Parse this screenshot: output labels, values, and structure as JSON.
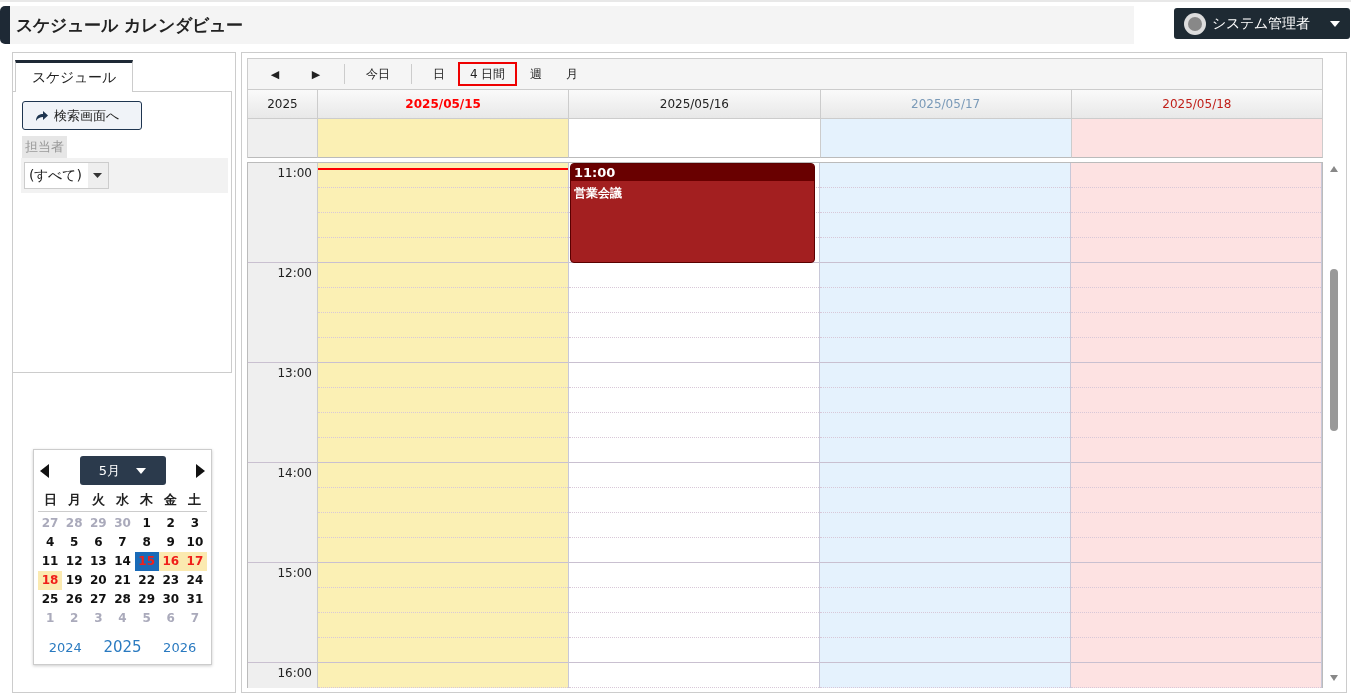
{
  "page_title": "スケジュール カレンダビュー",
  "user_menu": {
    "name": "システム管理者"
  },
  "sidebar": {
    "tabs": [
      {
        "label": "スケジュール",
        "selected": true
      }
    ],
    "search_button": "検索画面へ",
    "filter": {
      "label": "担当者",
      "value": "(すべて)"
    }
  },
  "mini_calendar": {
    "month": "5月",
    "weekdays": [
      "日",
      "月",
      "火",
      "水",
      "木",
      "金",
      "土"
    ],
    "weeks": [
      [
        {
          "day": "27",
          "in_month": false,
          "highlighted": false,
          "selected": false
        },
        {
          "day": "28",
          "in_month": false,
          "highlighted": false,
          "selected": false
        },
        {
          "day": "29",
          "in_month": false,
          "highlighted": false,
          "selected": false
        },
        {
          "day": "30",
          "in_month": false,
          "highlighted": false,
          "selected": false
        },
        {
          "day": "1",
          "in_month": true,
          "highlighted": false,
          "selected": false
        },
        {
          "day": "2",
          "in_month": true,
          "highlighted": false,
          "selected": false
        },
        {
          "day": "3",
          "in_month": true,
          "highlighted": false,
          "selected": false
        }
      ],
      [
        {
          "day": "4",
          "in_month": true,
          "highlighted": false,
          "selected": false
        },
        {
          "day": "5",
          "in_month": true,
          "highlighted": false,
          "selected": false
        },
        {
          "day": "6",
          "in_month": true,
          "highlighted": false,
          "selected": false
        },
        {
          "day": "7",
          "in_month": true,
          "highlighted": false,
          "selected": false
        },
        {
          "day": "8",
          "in_month": true,
          "highlighted": false,
          "selected": false
        },
        {
          "day": "9",
          "in_month": true,
          "highlighted": false,
          "selected": false
        },
        {
          "day": "10",
          "in_month": true,
          "highlighted": false,
          "selected": false
        }
      ],
      [
        {
          "day": "11",
          "in_month": true,
          "highlighted": false,
          "selected": false
        },
        {
          "day": "12",
          "in_month": true,
          "highlighted": false,
          "selected": false
        },
        {
          "day": "13",
          "in_month": true,
          "highlighted": false,
          "selected": false
        },
        {
          "day": "14",
          "in_month": true,
          "highlighted": false,
          "selected": false
        },
        {
          "day": "15",
          "in_month": true,
          "highlighted": true,
          "selected": true
        },
        {
          "day": "16",
          "in_month": true,
          "highlighted": true,
          "selected": false
        },
        {
          "day": "17",
          "in_month": true,
          "highlighted": true,
          "selected": false
        }
      ],
      [
        {
          "day": "18",
          "in_month": true,
          "highlighted": true,
          "selected": false
        },
        {
          "day": "19",
          "in_month": true,
          "highlighted": false,
          "selected": false
        },
        {
          "day": "20",
          "in_month": true,
          "highlighted": false,
          "selected": false
        },
        {
          "day": "21",
          "in_month": true,
          "highlighted": false,
          "selected": false
        },
        {
          "day": "22",
          "in_month": true,
          "highlighted": false,
          "selected": false
        },
        {
          "day": "23",
          "in_month": true,
          "highlighted": false,
          "selected": false
        },
        {
          "day": "24",
          "in_month": true,
          "highlighted": false,
          "selected": false
        }
      ],
      [
        {
          "day": "25",
          "in_month": true,
          "highlighted": false,
          "selected": false
        },
        {
          "day": "26",
          "in_month": true,
          "highlighted": false,
          "selected": false
        },
        {
          "day": "27",
          "in_month": true,
          "highlighted": false,
          "selected": false
        },
        {
          "day": "28",
          "in_month": true,
          "highlighted": false,
          "selected": false
        },
        {
          "day": "29",
          "in_month": true,
          "highlighted": false,
          "selected": false
        },
        {
          "day": "30",
          "in_month": true,
          "highlighted": false,
          "selected": false
        },
        {
          "day": "31",
          "in_month": true,
          "highlighted": false,
          "selected": false
        }
      ],
      [
        {
          "day": "1",
          "in_month": false,
          "highlighted": false,
          "selected": false
        },
        {
          "day": "2",
          "in_month": false,
          "highlighted": false,
          "selected": false
        },
        {
          "day": "3",
          "in_month": false,
          "highlighted": false,
          "selected": false
        },
        {
          "day": "4",
          "in_month": false,
          "highlighted": false,
          "selected": false
        },
        {
          "day": "5",
          "in_month": false,
          "highlighted": false,
          "selected": false
        },
        {
          "day": "6",
          "in_month": false,
          "highlighted": false,
          "selected": false
        },
        {
          "day": "7",
          "in_month": false,
          "highlighted": false,
          "selected": false
        }
      ]
    ],
    "years": [
      {
        "label": "2024",
        "selected": false
      },
      {
        "label": "2025",
        "selected": true
      },
      {
        "label": "2026",
        "selected": false
      }
    ]
  },
  "toolbar": {
    "nav": [
      "◀",
      "▶"
    ],
    "today": "今日",
    "views": [
      {
        "label": "日",
        "selected": false
      },
      {
        "label": "4 日間",
        "selected": true
      },
      {
        "label": "週",
        "selected": false
      },
      {
        "label": "月",
        "selected": false
      }
    ]
  },
  "calendar": {
    "year": "2025",
    "days": [
      {
        "date": "2025/05/15",
        "kind": "today"
      },
      {
        "date": "2025/05/16",
        "kind": "weekday",
        "events": [
          {
            "time": "11:00",
            "title": "営業会議"
          }
        ]
      },
      {
        "date": "2025/05/17",
        "kind": "saturday"
      },
      {
        "date": "2025/05/18",
        "kind": "sunday"
      }
    ],
    "hours": [
      "11:00",
      "12:00",
      "13:00",
      "14:00",
      "15:00",
      "16:00"
    ]
  }
}
